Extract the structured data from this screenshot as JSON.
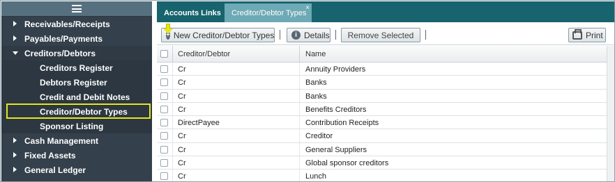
{
  "sidebar": {
    "menu_icon": "hamburger-icon",
    "items": [
      {
        "label": "Receivables/Receipts",
        "level": 0,
        "expanded": false
      },
      {
        "label": "Payables/Payments",
        "level": 0,
        "expanded": false
      },
      {
        "label": "Creditors/Debtors",
        "level": 0,
        "expanded": true
      },
      {
        "label": "Creditors Register",
        "level": 1
      },
      {
        "label": "Debtors Register",
        "level": 1
      },
      {
        "label": "Credit and Debit Notes",
        "level": 1
      },
      {
        "label": "Creditor/Debtor Types",
        "level": 1,
        "active": true
      },
      {
        "label": "Sponsor Listing",
        "level": 1
      },
      {
        "label": "Cash Management",
        "level": 0,
        "expanded": false
      },
      {
        "label": "Fixed Assets",
        "level": 0,
        "expanded": false
      },
      {
        "label": "General Ledger",
        "level": 0,
        "expanded": false
      }
    ]
  },
  "tabs": {
    "links": "Accounts Links",
    "active": "Creditor/Debtor Types",
    "close": "×"
  },
  "toolbar": {
    "new_label": "New Creditor/Debtor Types",
    "details_label": "Details",
    "remove_label": "Remove Selected",
    "print_label": "Print"
  },
  "grid": {
    "columns": [
      "Creditor/Debtor",
      "Name"
    ],
    "rows": [
      [
        "Cr",
        "Annuity Providers"
      ],
      [
        "Cr",
        "Banks"
      ],
      [
        "Cr",
        "Banks"
      ],
      [
        "Cr",
        "Benefits Creditors"
      ],
      [
        "DirectPayee",
        "Contribution Receipts"
      ],
      [
        "Cr",
        "Creditor"
      ],
      [
        "Cr",
        "General Suppliers"
      ],
      [
        "Cr",
        "Global sponsor creditors"
      ],
      [
        "Cr",
        "Lunch"
      ]
    ]
  },
  "colors": {
    "sidebar_bg": "#34404b",
    "tabbar_bg": "#17636e",
    "active_tab": "#6ea9b6",
    "highlight": "#e6e61e"
  }
}
